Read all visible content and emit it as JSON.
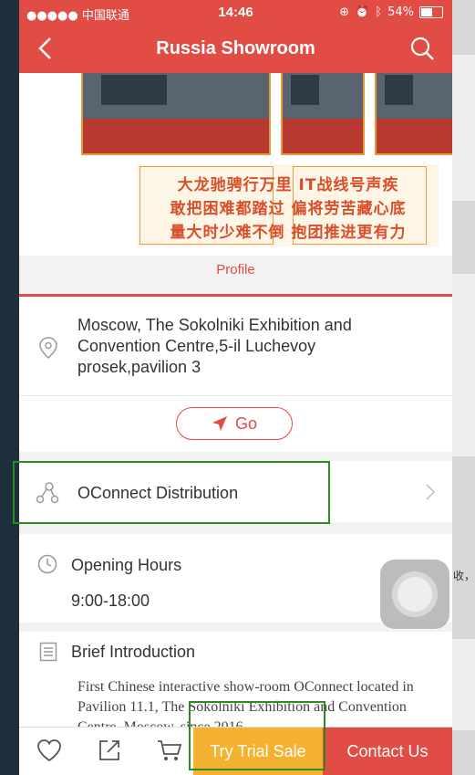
{
  "status_bar": {
    "carrier": "●●●●● 中国联通",
    "time": "14:46",
    "battery": "54%"
  },
  "nav": {
    "title": "Russia Showroom"
  },
  "banner": {
    "calligraphy_line1": "大龙驰骋行万里  IT战线号声疾",
    "calligraphy_line2": "敢把困难都踏过  偏将劳苦藏心底",
    "calligraphy_line3": "量大时少难不倒  抱团推进更有力"
  },
  "profile_link": "Profile",
  "address": {
    "text": "Moscow, The Sokolniki Exhibition and Convention Centre,5-il Luchevoy prosek,pavilion 3",
    "go_label": "Go"
  },
  "distribution": {
    "label": "OConnect Distribution"
  },
  "opening_hours": {
    "label": "Opening Hours",
    "value": "9:00-18:00"
  },
  "brief": {
    "label": "Brief Introduction",
    "text": "First Chinese interactive show-room OConnect located in Pavilion 11.1, The Sokolniki Exhibition and Convention Centre, Moscow, since 2016"
  },
  "bottom_bar": {
    "trial_label": "Try Trial Sale",
    "contact_label": "Contact Us"
  },
  "external_text": "收，",
  "colors": {
    "brand_red": "#e14c45",
    "trial_orange": "#f5b230",
    "highlight_green": "#2e8b1f"
  }
}
